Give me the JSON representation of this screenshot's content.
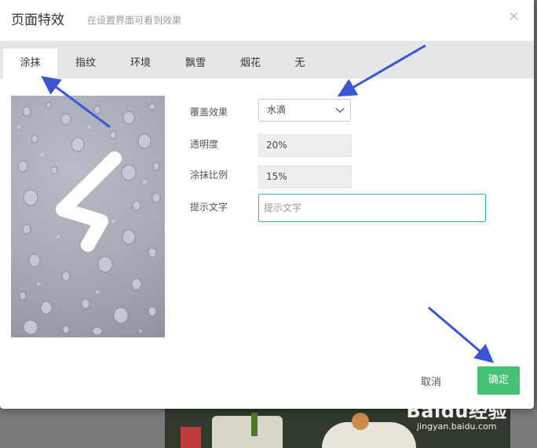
{
  "dialog": {
    "title": "页面特效",
    "subtitle": "在设置界面可看到效果",
    "close_glyph": "×"
  },
  "tabs": [
    {
      "label": "涂抹",
      "active": true
    },
    {
      "label": "指纹",
      "active": false
    },
    {
      "label": "环境",
      "active": false
    },
    {
      "label": "飘雪",
      "active": false
    },
    {
      "label": "烟花",
      "active": false
    },
    {
      "label": "无",
      "active": false
    }
  ],
  "form": {
    "overlay_label": "覆盖效果",
    "overlay_value": "水滴",
    "opacity_label": "透明度",
    "opacity_value": "20%",
    "smear_label": "涂抹比例",
    "smear_value": "15%",
    "hint_label": "提示文字",
    "hint_placeholder": "提示文字"
  },
  "buttons": {
    "cancel": "取消",
    "ok": "确定"
  },
  "watermark": {
    "logo": "Baidu经验",
    "url": "jingyan.baidu.com"
  },
  "colors": {
    "accent_green": "#44c173",
    "focus_border": "#3fb0c8",
    "arrow_blue": "#3a56d4",
    "tabbar_bg": "#e6e6e6"
  },
  "icons": [
    "close-icon",
    "chevron-down-icon",
    "pointer-arrow"
  ]
}
